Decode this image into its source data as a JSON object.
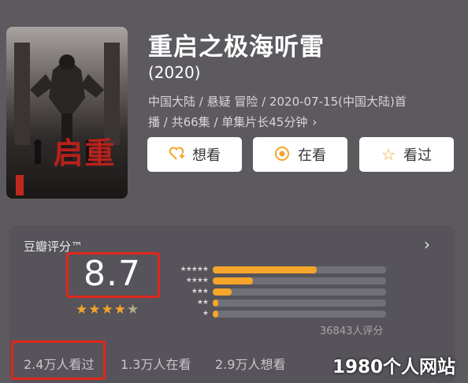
{
  "movie": {
    "title": "重启之极海听雷",
    "year": "(2020)",
    "meta_line1": "中国大陆 / 悬疑 冒险 / 2020-07-15(中国大陆)首",
    "meta_line2": "播 / 共66集 / 单集片长45分钟",
    "meta_chevron": "›",
    "poster_title": "重启"
  },
  "actions": {
    "want": {
      "label": "想看",
      "icon": "heart-plus-icon"
    },
    "watching": {
      "label": "在看",
      "icon": "dot-circle-icon"
    },
    "watched": {
      "label": "看过",
      "icon": "star-outline-icon"
    }
  },
  "rating": {
    "title": "豆瓣评分™",
    "chevron": "›",
    "score": "8.7",
    "stars": 4.5,
    "distribution": [
      {
        "stars": "★★★★★",
        "fraction": 0.6
      },
      {
        "stars": "★★★★",
        "fraction": 0.23
      },
      {
        "stars": "★★★",
        "fraction": 0.11
      },
      {
        "stars": "★★",
        "fraction": 0.03
      },
      {
        "stars": "★",
        "fraction": 0.03
      }
    ],
    "count": "36843人评分"
  },
  "stats": {
    "watched": "2.4万人看过",
    "watching": "1.3万人在看",
    "want": "2.9万人想看"
  },
  "watermark": "1980个人网站",
  "colors": {
    "accent": "#f3a52a",
    "highlight_box": "#e1261c",
    "background": "#5d5a5f"
  }
}
